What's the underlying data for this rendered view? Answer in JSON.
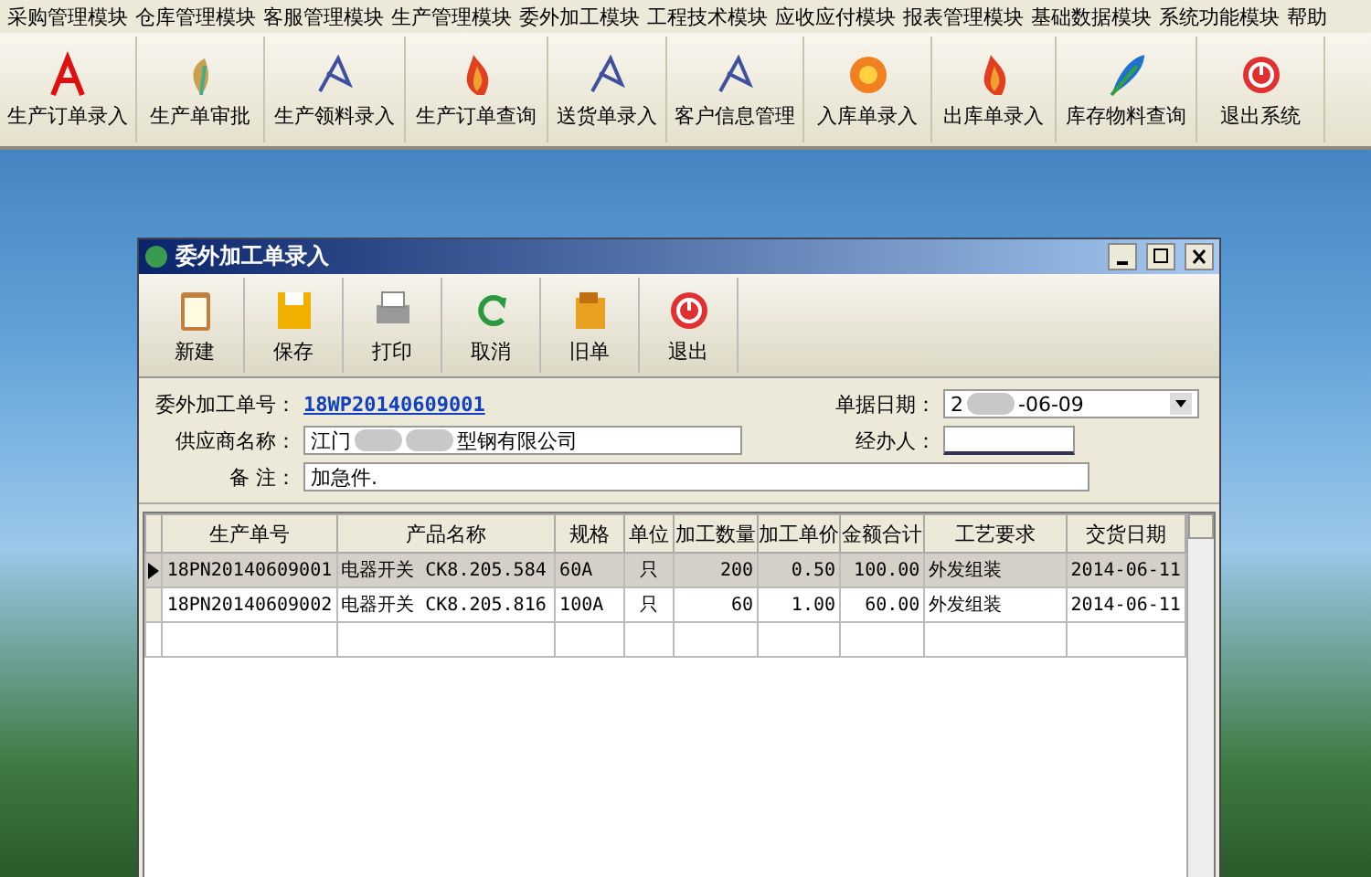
{
  "menu": [
    "采购管理模块",
    "仓库管理模块",
    "客服管理模块",
    "生产管理模块",
    "委外加工模块",
    "工程技术模块",
    "应收应付模块",
    "报表管理模块",
    "基础数据模块",
    "系统功能模块",
    "帮助"
  ],
  "toolbar": [
    {
      "label": "生产订单录入",
      "kind": "pdf"
    },
    {
      "label": "生产单审批",
      "kind": "leaf"
    },
    {
      "label": "生产领料录入",
      "kind": "sketch"
    },
    {
      "label": "生产订单查询",
      "kind": "flame"
    },
    {
      "label": "送货单录入",
      "kind": "sketch"
    },
    {
      "label": "客户信息管理",
      "kind": "sketch"
    },
    {
      "label": "入库单录入",
      "kind": "flower"
    },
    {
      "label": "出库单录入",
      "kind": "flame"
    },
    {
      "label": "库存物料查询",
      "kind": "feather"
    },
    {
      "label": "退出系统",
      "kind": "power"
    }
  ],
  "window": {
    "title": "委外加工单录入",
    "toolbar": [
      {
        "label": "新建",
        "kind": "clipboard"
      },
      {
        "label": "保存",
        "kind": "disk"
      },
      {
        "label": "打印",
        "kind": "printer"
      },
      {
        "label": "取消",
        "kind": "undo"
      },
      {
        "label": "旧单",
        "kind": "folder"
      },
      {
        "label": "退出",
        "kind": "power"
      }
    ],
    "form": {
      "order_no_label": "委外加工单号：",
      "order_no": "18WP20140609001",
      "date_label": "单据日期：",
      "date_start": "2",
      "date_end": "-06-09",
      "supplier_label": "供应商名称：",
      "supplier_start": "江门",
      "supplier_end": "型钢有限公司",
      "handler_label": "经办人：",
      "note_label": "备  注：",
      "note": "加急件."
    },
    "table": {
      "columns": [
        "生产单号",
        "产品名称",
        "规格",
        "单位",
        "加工数量",
        "加工单价",
        "金额合计",
        "工艺要求",
        "交货日期"
      ],
      "rows": [
        {
          "selected": true,
          "cells": [
            "18PN20140609001",
            "电器开关 CK8.205.584",
            "60A",
            "只",
            "200",
            "0.50",
            "100.00",
            "外发组装",
            "2014-06-11"
          ]
        },
        {
          "selected": false,
          "cells": [
            "18PN20140609002",
            "电器开关 CK8.205.816",
            "100A",
            "只",
            "60",
            "1.00",
            "60.00",
            "外发组装",
            "2014-06-11"
          ]
        }
      ]
    }
  }
}
